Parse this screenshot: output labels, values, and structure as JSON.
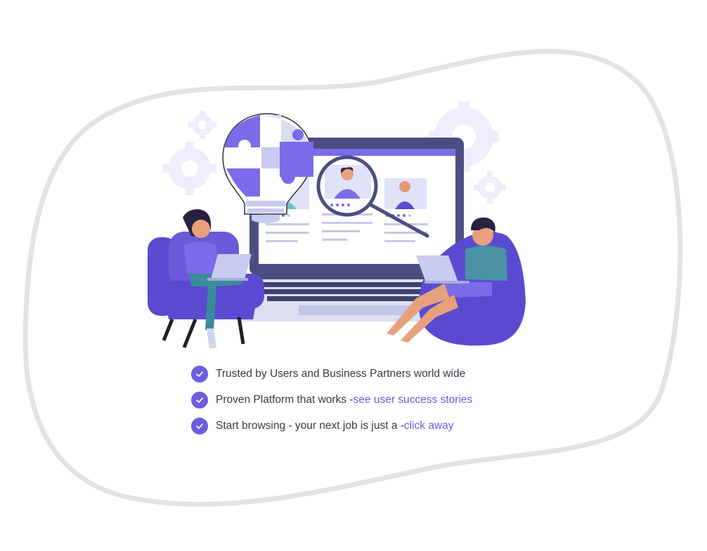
{
  "colors": {
    "accent": "#6c5ce0",
    "text": "#3a3a44",
    "blob_outline": "#e3e3e3",
    "gear": "#eeedfb"
  },
  "illustration": {
    "icons": [
      "gear-icon",
      "lightbulb-puzzle-icon",
      "laptop-icon",
      "magnifier-icon",
      "profile-card-icon",
      "star-icon",
      "armchair-icon",
      "beanbag-icon"
    ]
  },
  "features": [
    {
      "icon": "check-circle-icon",
      "text": "Trusted by Users and Business Partners world wide",
      "link": ""
    },
    {
      "icon": "check-circle-icon",
      "text": "Proven Platform that works - ",
      "link": "see user success stories"
    },
    {
      "icon": "check-circle-icon",
      "text": "Start browsing - your next job is just a - ",
      "link": "click away"
    }
  ]
}
